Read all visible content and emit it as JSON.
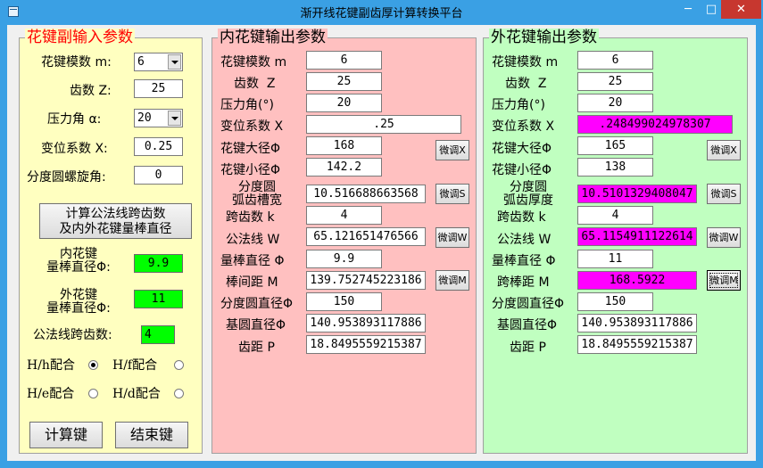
{
  "window": {
    "title": "渐开线花键副齿厚计算转换平台",
    "min": "─",
    "max": "□",
    "close": "✕"
  },
  "colors": {
    "left_panel": "#ffffc0",
    "middle_panel": "#ffc0c0",
    "right_panel": "#c0ffc0",
    "highlight": "#ff00ff",
    "result": "#00ff00"
  },
  "left": {
    "title": "花键副输入参数",
    "module_label": "花键模数 m:",
    "module_value": "6",
    "teeth_label": "齿数 Z:",
    "teeth_value": "25",
    "pressure_label": "压力角 α:",
    "pressure_value": "20",
    "shift_label": "变位系数 X:",
    "shift_value": "0.25",
    "helix_label": "分度圆螺旋角:",
    "helix_value": "0",
    "calc_span_button": "计算公法线跨齿数\n及内外花键量棒直径",
    "inner_pin_label": "内花键\n量棒直径Φ:",
    "inner_pin_value": "9.9",
    "outer_pin_label": "外花键\n量棒直径Φ:",
    "outer_pin_value": "11",
    "span_count_label": "公法线跨齿数:",
    "span_count_value": "4",
    "fit_hh": "H/h配合",
    "fit_hf": "H/f配合",
    "fit_he": "H/e配合",
    "fit_hd": "H/d配合",
    "calc_button": "计算键",
    "end_button": "结束键"
  },
  "middle": {
    "title": "内花键输出参数",
    "rows": {
      "module": {
        "label": "花键模数 m",
        "value": "6"
      },
      "teeth": {
        "label": "齿数  Z",
        "value": "25"
      },
      "pressure": {
        "label": "压力角(°)",
        "value": "20"
      },
      "shift": {
        "label": "变位系数 X",
        "value": ".25"
      },
      "major": {
        "label": "花键大径Φ",
        "value": "168"
      },
      "minor": {
        "label": "花键小径Φ",
        "value": "142.2"
      },
      "space": {
        "label": "分度圆\n弧齿槽宽",
        "value": "10.516688663568"
      },
      "span": {
        "label": "跨齿数 k",
        "value": "4"
      },
      "wk": {
        "label": "公法线 W",
        "value": "65.121651476566"
      },
      "pin": {
        "label": "量棒直径 Φ",
        "value": "9.9"
      },
      "between": {
        "label": "棒间距 M",
        "value": "139.752745223186"
      },
      "pitch_dia": {
        "label": "分度圆直径Φ",
        "value": "150"
      },
      "base_dia": {
        "label": "基圆直径Φ",
        "value": "140.953893117886"
      },
      "pitch": {
        "label": "齿距 P",
        "value": "18.8495559215387"
      }
    },
    "adj_x": "微调X",
    "adj_s": "微调S",
    "adj_w": "微调W",
    "adj_m": "微调M"
  },
  "right": {
    "title": "外花键输出参数",
    "rows": {
      "module": {
        "label": "花键模数 m",
        "value": "6"
      },
      "teeth": {
        "label": "齿数  Z",
        "value": "25"
      },
      "pressure": {
        "label": "压力角(°)",
        "value": "20"
      },
      "shift": {
        "label": "变位系数 X",
        "value": ".248499024978307"
      },
      "major": {
        "label": "花键大径Φ",
        "value": "165"
      },
      "minor": {
        "label": "花键小径Φ",
        "value": "138"
      },
      "thick": {
        "label": "分度圆\n弧齿厚度",
        "value": "10.5101329408047"
      },
      "span": {
        "label": "跨齿数 k",
        "value": "4"
      },
      "wk": {
        "label": "公法线 W",
        "value": "65.1154911122614"
      },
      "pin": {
        "label": "量棒直径 Φ",
        "value": "11"
      },
      "over": {
        "label": "跨棒距 M",
        "value": "168.5922"
      },
      "pitch_dia": {
        "label": "分度圆直径Φ",
        "value": "150"
      },
      "base_dia": {
        "label": "基圆直径Φ",
        "value": "140.953893117886"
      },
      "pitch": {
        "label": "齿距 P",
        "value": "18.8495559215387"
      }
    },
    "adj_x": "微调X",
    "adj_s": "微调S",
    "adj_w": "微调W",
    "adj_m": "微调M"
  }
}
